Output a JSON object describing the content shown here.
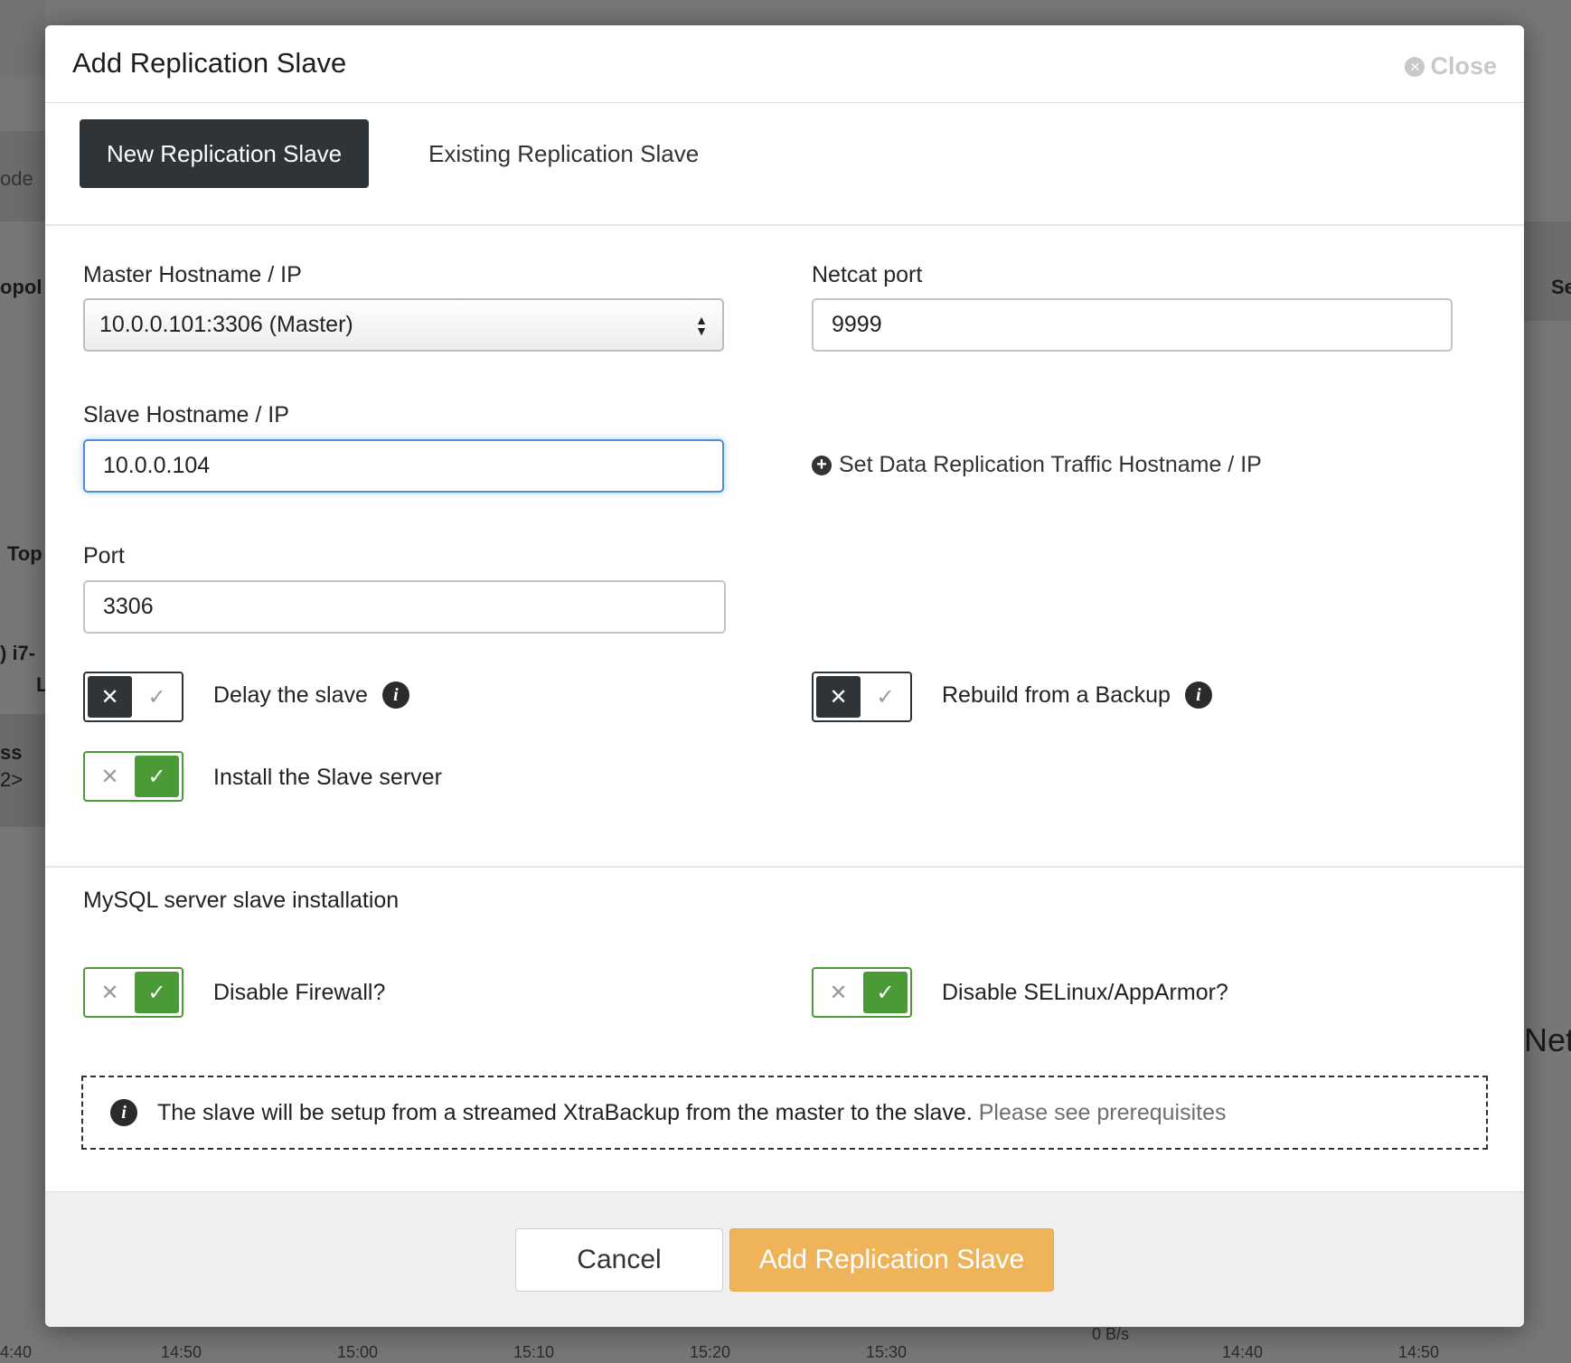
{
  "background": {
    "fragments": [
      "ode",
      "opol",
      "Top",
      ") i7-",
      "L",
      "ss",
      "2>",
      "Se",
      "Net"
    ],
    "axis_left": [
      "4:40",
      "14:50",
      "15:00",
      "15:10",
      "15:20",
      "15:30"
    ],
    "axis_right": [
      "14:40",
      "14:50"
    ],
    "rate_label": "0 B/s"
  },
  "modal": {
    "title": "Add Replication Slave",
    "close_label": "Close",
    "tabs": [
      {
        "label": "New Replication Slave",
        "active": true
      },
      {
        "label": "Existing Replication Slave",
        "active": false
      }
    ],
    "form": {
      "master_label": "Master Hostname / IP",
      "master_value": "10.0.0.101:3306 (Master)",
      "netcat_label": "Netcat port",
      "netcat_value": "9999",
      "slave_label": "Slave Hostname / IP",
      "slave_value": "10.0.0.104",
      "set_traffic_label": "Set Data Replication Traffic Hostname / IP",
      "port_label": "Port",
      "port_value": "3306",
      "options": [
        {
          "label": "Delay the slave",
          "checked": false,
          "has_info": true
        },
        {
          "label": "Rebuild from a Backup",
          "checked": false,
          "has_info": true
        },
        {
          "label": "Install the Slave server",
          "checked": true,
          "has_info": false
        }
      ]
    },
    "install": {
      "title": "MySQL server slave installation",
      "options": [
        {
          "label": "Disable Firewall?",
          "checked": true
        },
        {
          "label": "Disable SELinux/AppArmor?",
          "checked": true
        }
      ],
      "notice_text": "The slave will be setup from a streamed XtraBackup from the master to the slave.",
      "notice_link": "Please see prerequisites"
    },
    "footer": {
      "cancel_label": "Cancel",
      "submit_label": "Add Replication Slave"
    }
  },
  "colors": {
    "primary_button": "#efb45a",
    "toggle_on": "#4a9a36",
    "toggle_off": "#2f3438",
    "focus_border": "#4a90d9"
  }
}
